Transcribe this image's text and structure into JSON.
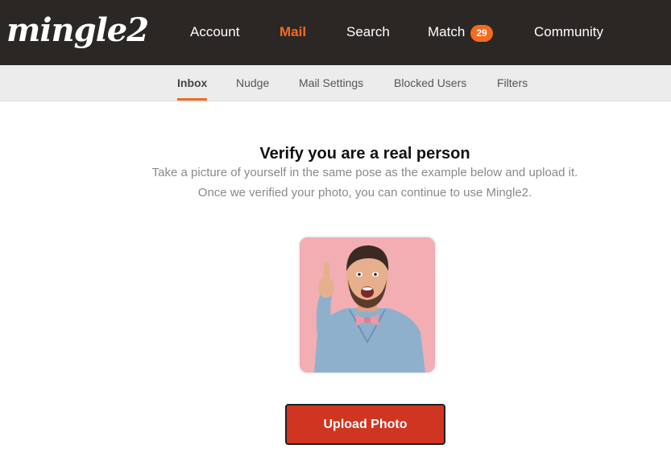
{
  "brand": {
    "logo_text": "mingle2"
  },
  "nav": {
    "items": [
      {
        "label": "Account"
      },
      {
        "label": "Mail"
      },
      {
        "label": "Search"
      },
      {
        "label": "Match"
      },
      {
        "label": "Community"
      }
    ],
    "match_badge": "29",
    "active": "Mail",
    "accent_color": "#f26b21"
  },
  "subnav": {
    "items": [
      {
        "label": "Inbox"
      },
      {
        "label": "Nudge"
      },
      {
        "label": "Mail Settings"
      },
      {
        "label": "Blocked Users"
      },
      {
        "label": "Filters"
      }
    ],
    "active": "Inbox"
  },
  "verify": {
    "title": "Verify you are a real person",
    "line1": "Take a picture of yourself in the same pose as the example below and upload it.",
    "line2": "Once we verified your photo, you can continue to use Mingle2.",
    "example_photo_icon": "example-pose-photo",
    "upload_label": "Upload Photo",
    "upload_color": "#cf3520"
  }
}
